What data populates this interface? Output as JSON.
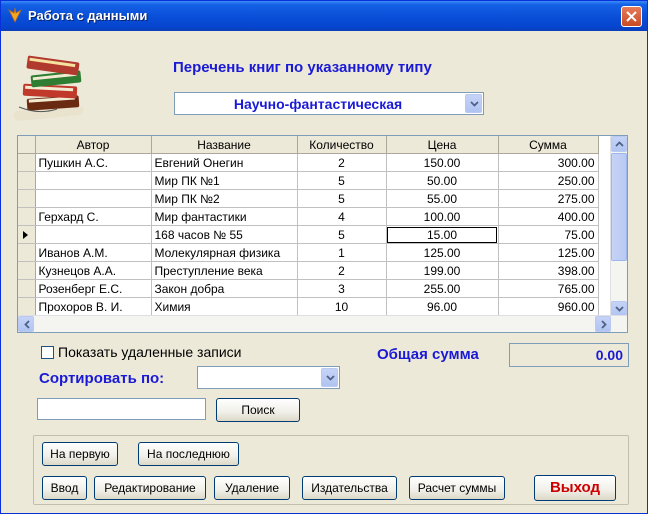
{
  "window": {
    "title": "Работа с данными",
    "accent": "#0a50d8"
  },
  "header": {
    "heading": "Перечень книг по указанному типу",
    "type_selected": "Научно-фантастическая"
  },
  "grid": {
    "columns": [
      "Автор",
      "Название",
      "Количество",
      "Цена",
      "Сумма"
    ],
    "rows": [
      [
        "Пушкин А.С.",
        "Евгений Онегин",
        "2",
        "150.00",
        "300.00"
      ],
      [
        "",
        "Мир ПК №1",
        "5",
        "50.00",
        "250.00"
      ],
      [
        "",
        "Мир ПК №2",
        "5",
        "55.00",
        "275.00"
      ],
      [
        "Герхард С.",
        "Мир фантастики",
        "4",
        "100.00",
        "400.00"
      ],
      [
        "",
        "168 часов № 55",
        "5",
        "15.00",
        "75.00"
      ],
      [
        "Иванов А.М.",
        "Молекулярная физика",
        "1",
        "125.00",
        "125.00"
      ],
      [
        "Кузнецов А.А.",
        "Преступление века",
        "2",
        "199.00",
        "398.00"
      ],
      [
        "Розенберг Е.С.",
        "Закон добра",
        "3",
        "255.00",
        "765.00"
      ],
      [
        "Прохоров В. И.",
        "Химия",
        "10",
        "96.00",
        "960.00"
      ]
    ],
    "current_row_index": 4
  },
  "options": {
    "show_deleted_label": "Показать удаленные записи",
    "show_deleted_checked": false
  },
  "total": {
    "label": "Общая сумма",
    "value": "0.00"
  },
  "sort": {
    "label": "Сортировать по:",
    "selected": ""
  },
  "search": {
    "value": "",
    "button_label": "Поиск"
  },
  "nav": {
    "first_label": "На первую",
    "last_label": "На последнюю"
  },
  "actions": {
    "input_label": "Ввод",
    "edit_label": "Редактирование",
    "delete_label": "Удаление",
    "publishers_label": "Издательства",
    "calc_label": "Расчет суммы",
    "exit_label": "Выход"
  },
  "icons": [
    "app-icon",
    "close-icon",
    "books-icon",
    "chevron-down-icon",
    "row-pointer-icon",
    "scroll-up-icon",
    "scroll-down-icon",
    "scroll-left-icon",
    "scroll-right-icon"
  ]
}
